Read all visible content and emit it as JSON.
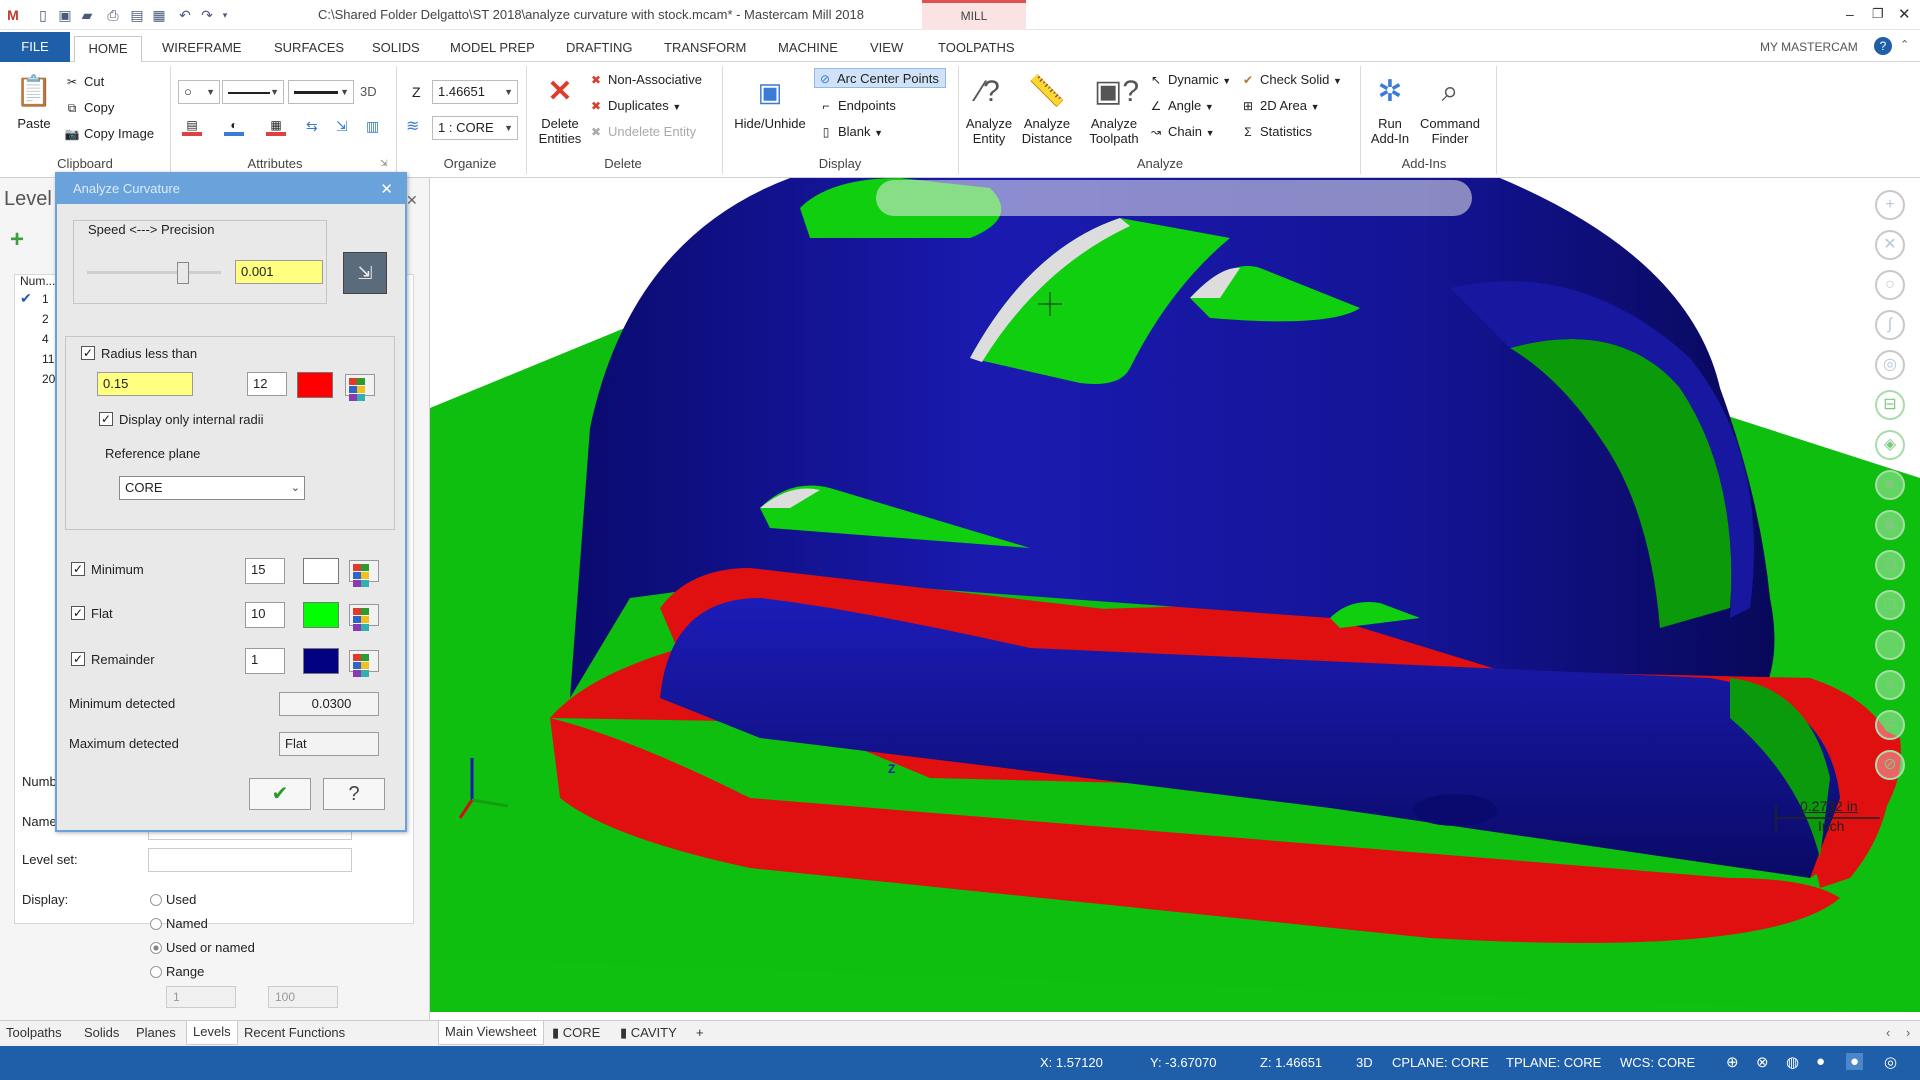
{
  "app": {
    "title": "C:\\Shared Folder Delgatto\\ST 2018\\analyze curvature with stock.mcam* - Mastercam Mill 2018",
    "context_tab": "MILL",
    "account": "MY MASTERCAM",
    "window_controls": [
      "minimize-icon",
      "restore-icon",
      "close-icon"
    ]
  },
  "ribbon_tabs": [
    "FILE",
    "HOME",
    "WIREFRAME",
    "SURFACES",
    "SOLIDS",
    "MODEL PREP",
    "DRAFTING",
    "TRANSFORM",
    "MACHINE",
    "VIEW",
    "TOOLPATHS"
  ],
  "active_tab": "HOME",
  "ribbon": {
    "clipboard": {
      "label": "Clipboard",
      "paste": "Paste",
      "cut": "Cut",
      "copy": "Copy",
      "copy_image": "Copy Image"
    },
    "attributes": {
      "label": "Attributes",
      "mode_3d": "3D"
    },
    "organize": {
      "label": "Organize",
      "z_label": "Z",
      "z_value": "1.46651",
      "level_value": "1 : CORE"
    },
    "delete": {
      "label": "Delete",
      "delete_entities": "Delete Entities",
      "non_associative": "Non-Associative",
      "duplicates": "Duplicates",
      "undelete": "Undelete Entity"
    },
    "display": {
      "label": "Display",
      "hide_unhide": "Hide/Unhide",
      "arc_center_points": "Arc Center Points",
      "endpoints": "Endpoints",
      "blank": "Blank"
    },
    "analyze": {
      "label": "Analyze",
      "analyze_entity": "Analyze Entity",
      "analyze_distance": "Analyze Distance",
      "analyze_toolpath": "Analyze Toolpath",
      "dynamic": "Dynamic",
      "angle": "Angle",
      "chain": "Chain",
      "check_solid": "Check Solid",
      "area_2d": "2D Area",
      "statistics": "Statistics"
    },
    "addins": {
      "label": "Add-Ins",
      "run_addin": "Run Add-In",
      "command_finder": "Command Finder"
    }
  },
  "levels_panel": {
    "title": "Level",
    "col_number": "Num...",
    "rows": [
      "1",
      "2",
      "4",
      "11",
      "20"
    ],
    "number_label": "Numb",
    "name_label": "Name",
    "level_set_label": "Level set:",
    "display_label": "Display:",
    "display_options": [
      "Used",
      "Named",
      "Used or named",
      "Range"
    ],
    "selected_option": "Used or named",
    "range_from": "1",
    "range_to": "100"
  },
  "bottom_tabs": [
    "Toolpaths",
    "Solids",
    "Planes",
    "Levels",
    "Recent Functions"
  ],
  "active_bottom_tab": "Levels",
  "dialog": {
    "title": "Analyze Curvature",
    "speed_precision_label": "Speed <---> Precision",
    "precision_value": "0.001",
    "radius_less_than_label": "Radius less than",
    "radius_value": "0.15",
    "radius_color_num": "12",
    "radius_color": "#ff0000",
    "internal_radii_label": "Display only internal radii",
    "reference_plane_label": "Reference plane",
    "reference_plane_value": "CORE",
    "minimum_label": "Minimum",
    "minimum_color_num": "15",
    "minimum_color": "#ffffff",
    "flat_label": "Flat",
    "flat_color_num": "10",
    "flat_color": "#00ff00",
    "remainder_label": "Remainder",
    "remainder_color_num": "1",
    "remainder_color": "#000080",
    "minimum_detected_label": "Minimum detected",
    "minimum_detected_value": "0.0300",
    "maximum_detected_label": "Maximum detected",
    "maximum_detected_value": "Flat"
  },
  "viewport": {
    "scale_value": "0.2732 in",
    "scale_unit": "Inch",
    "axis_label": "Z"
  },
  "viewsheets": [
    "Main Viewsheet",
    "CORE",
    "CAVITY",
    "+"
  ],
  "status": {
    "x": "X:  1.57120",
    "y": "Y:  -3.67070",
    "z": "Z:  1.46651",
    "mode": "3D",
    "cplane": "CPLANE: CORE",
    "tplane": "TPLANE: CORE",
    "wcs": "WCS: CORE"
  },
  "colors": {
    "status_bar": "#1f5ea8",
    "file_tab": "#1f5ea8",
    "dialog_title": "#6aa3db"
  }
}
